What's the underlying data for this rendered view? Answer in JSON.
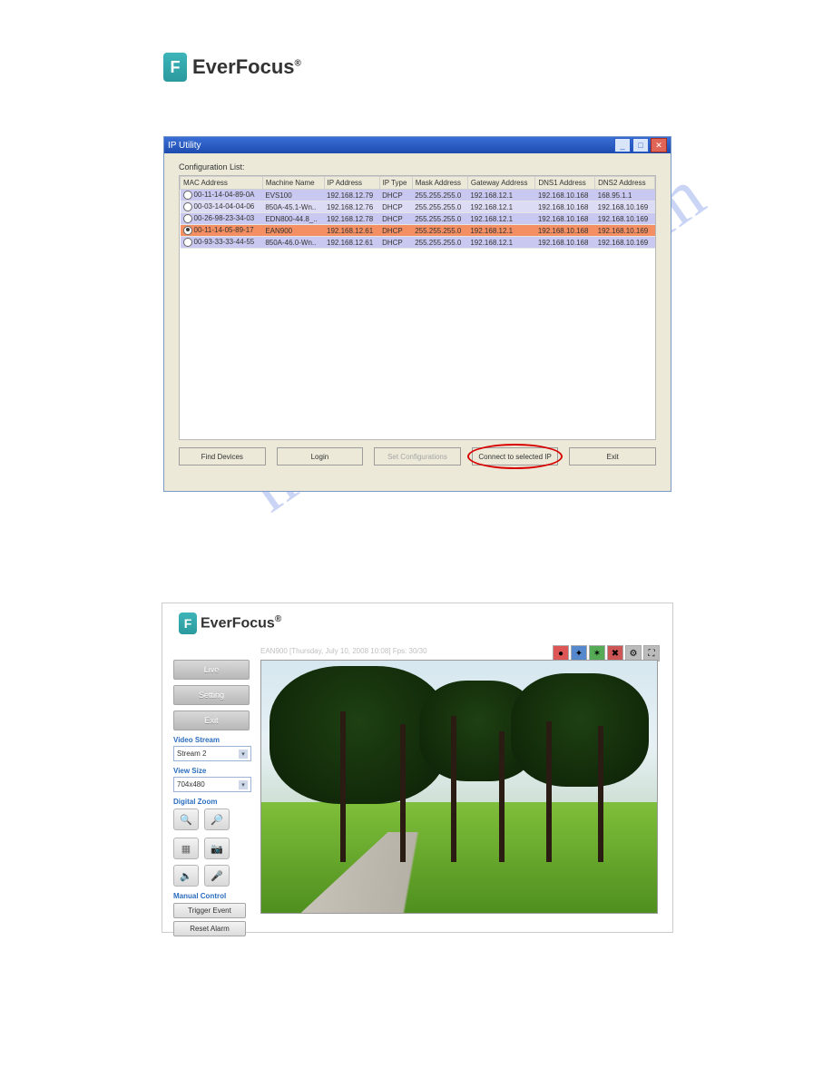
{
  "logo_text": "EverFocus",
  "watermark": "manualshive.com",
  "ip_utility": {
    "title": "IP Utility",
    "list_label": "Configuration List:",
    "columns": [
      "MAC Address",
      "Machine Name",
      "IP Address",
      "IP Type",
      "Mask Address",
      "Gateway Address",
      "DNS1 Address",
      "DNS2 Address"
    ],
    "rows": [
      {
        "sel": false,
        "cells": [
          "00-11-14-04-89-0A",
          "EVS100",
          "192.168.12.79",
          "DHCP",
          "255.255.255.0",
          "192.168.12.1",
          "192.168.10.168",
          "168.95.1.1"
        ]
      },
      {
        "sel": false,
        "cells": [
          "00-03-14-04-04-06",
          "850A-45.1-Wn..",
          "192.168.12.76",
          "DHCP",
          "255.255.255.0",
          "192.168.12.1",
          "192.168.10.168",
          "192.168.10.169"
        ]
      },
      {
        "sel": false,
        "cells": [
          "00-26-98-23-34-03",
          "EDN800-44.8_..",
          "192.168.12.78",
          "DHCP",
          "255.255.255.0",
          "192.168.12.1",
          "192.168.10.168",
          "192.168.10.169"
        ]
      },
      {
        "sel": true,
        "cells": [
          "00-11-14-05-89-17",
          "EAN900",
          "192.168.12.61",
          "DHCP",
          "255.255.255.0",
          "192.168.12.1",
          "192.168.10.168",
          "192.168.10.169"
        ]
      },
      {
        "sel": false,
        "cells": [
          "00-93-33-33-44-55",
          "850A-46.0-Wn..",
          "192.168.12.61",
          "DHCP",
          "255.255.255.0",
          "192.168.12.1",
          "192.168.10.168",
          "192.168.10.169"
        ]
      }
    ],
    "buttons": {
      "find": "Find Devices",
      "login": "Login",
      "setcfg": "Set Configurations",
      "connect": "Connect to selected IP",
      "exit": "Exit"
    }
  },
  "web_ui": {
    "info_line": "EAN900 [Thursday, July 10, 2008 10:08] Fps: 30/30",
    "nav": {
      "live": "Live",
      "setting": "Setting",
      "exit": "Exit"
    },
    "video_stream": {
      "label": "Video Stream",
      "value": "Stream 2"
    },
    "view_size": {
      "label": "View Size",
      "value": "704x480"
    },
    "digital_zoom": {
      "label": "Digital Zoom"
    },
    "manual_control": {
      "label": "Manual Control",
      "trigger": "Trigger Event",
      "reset": "Reset Alarm"
    }
  }
}
